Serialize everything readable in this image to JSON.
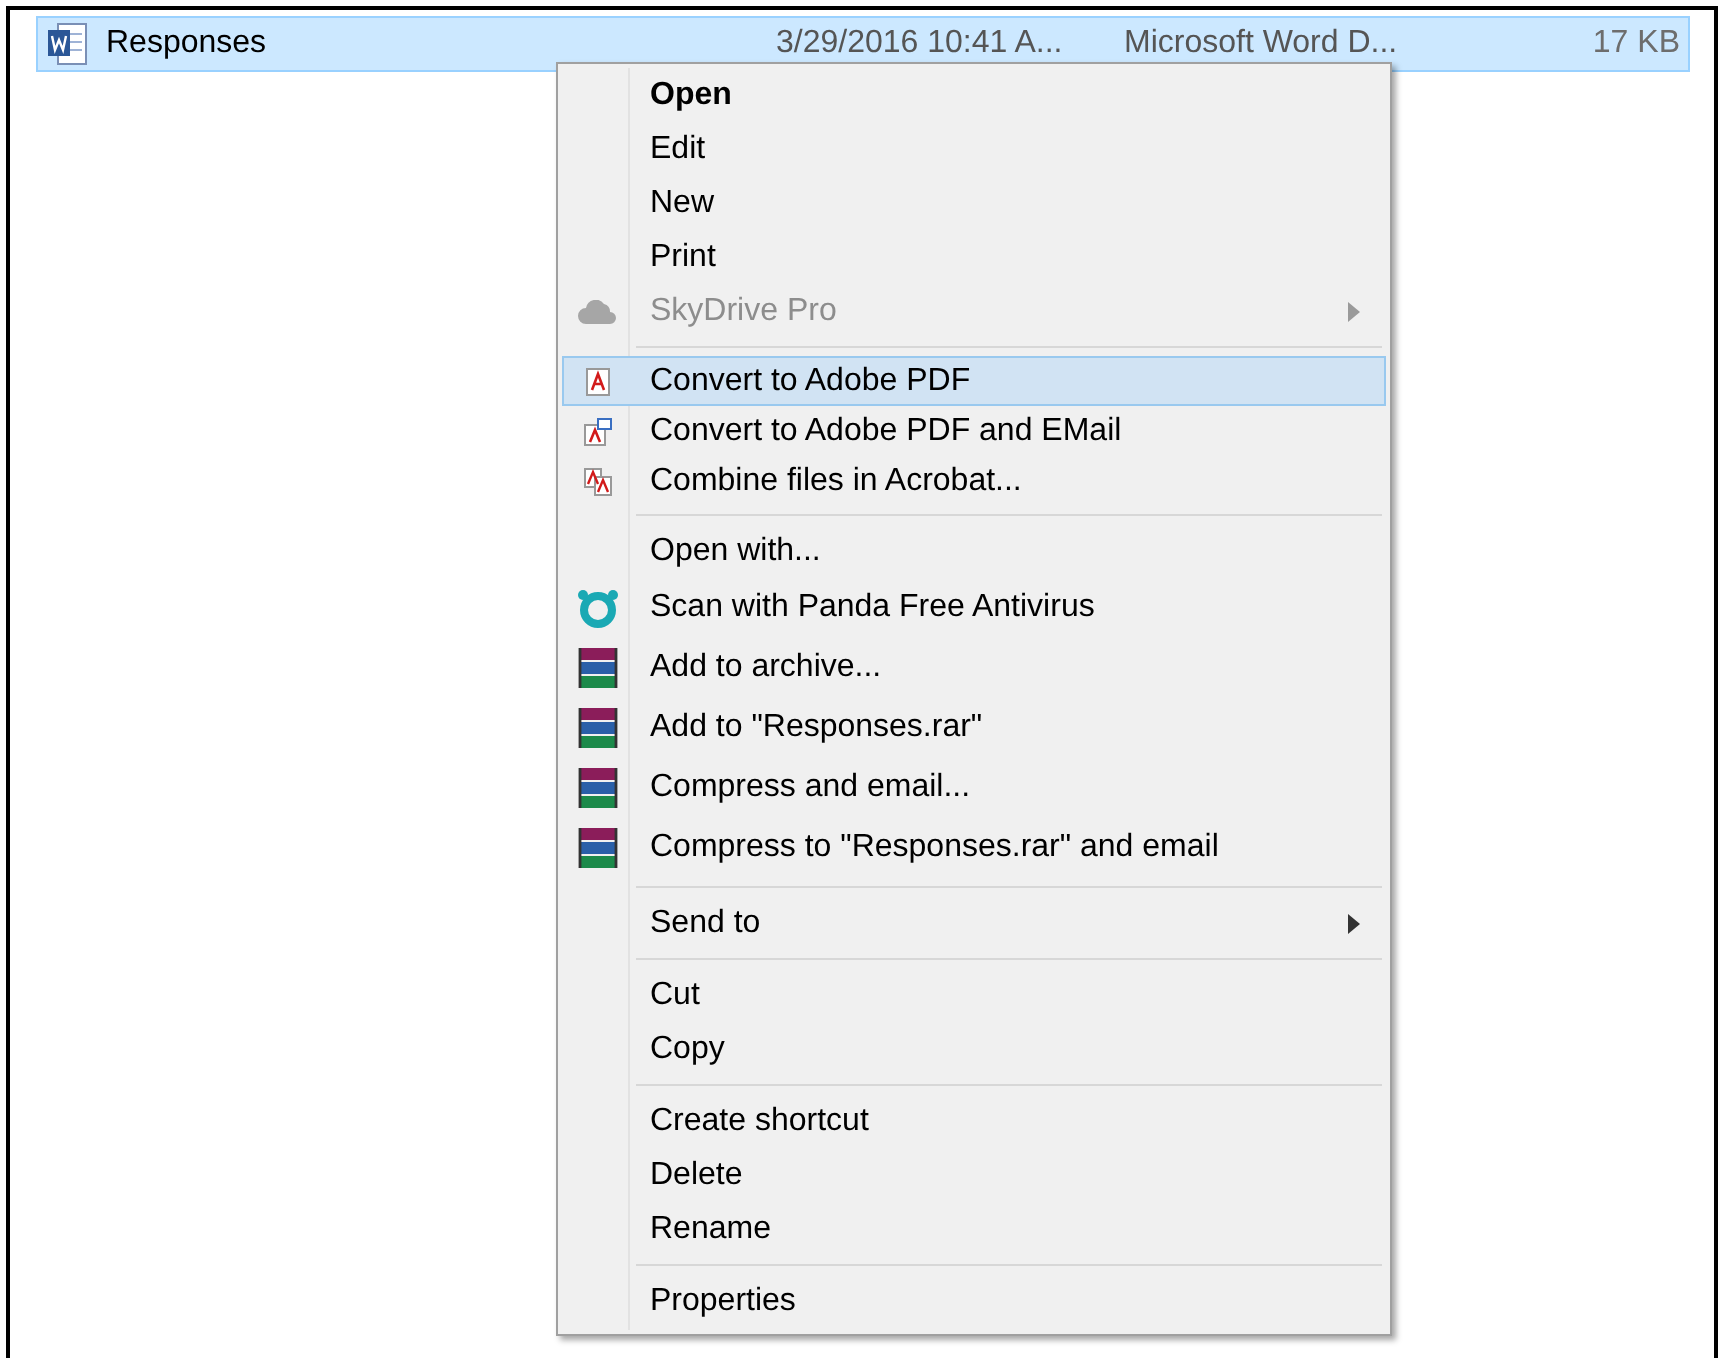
{
  "file_row": {
    "name": "Responses",
    "date": "3/29/2016 10:41 A...",
    "type": "Microsoft Word D...",
    "size": "17 KB",
    "selected": true
  },
  "context_menu": {
    "groups": [
      {
        "items": [
          {
            "label": "Open",
            "bold": true,
            "selected": false,
            "disabled": false,
            "submenu": false
          },
          {
            "label": "Edit",
            "bold": false,
            "selected": false,
            "disabled": false,
            "submenu": false
          },
          {
            "label": "New",
            "bold": false,
            "selected": false,
            "disabled": false,
            "submenu": false
          },
          {
            "label": "Print",
            "bold": false,
            "selected": false,
            "disabled": false,
            "submenu": false
          },
          {
            "label": "SkyDrive Pro",
            "kind": "cloud",
            "bold": false,
            "selected": false,
            "disabled": true,
            "submenu": true
          }
        ]
      },
      {
        "items": [
          {
            "label": "Convert to Adobe PDF",
            "kind": "pdf",
            "bold": false,
            "selected": true,
            "disabled": false,
            "submenu": false
          },
          {
            "label": "Convert to Adobe PDF and EMail",
            "kind": "pdf-mail",
            "bold": false,
            "selected": false,
            "disabled": false,
            "submenu": false
          },
          {
            "label": "Combine files in Acrobat...",
            "kind": "pdf-combine",
            "bold": false,
            "selected": false,
            "disabled": false,
            "submenu": false
          }
        ]
      },
      {
        "items": [
          {
            "label": "Open with...",
            "bold": false,
            "selected": false,
            "disabled": false,
            "submenu": false
          },
          {
            "label": "Scan with Panda Free Antivirus",
            "kind": "panda",
            "bold": false,
            "selected": false,
            "disabled": false,
            "submenu": false
          },
          {
            "label": "Add to archive...",
            "kind": "books",
            "bold": false,
            "selected": false,
            "disabled": false,
            "submenu": false
          },
          {
            "label": "Add to \"Responses.rar\"",
            "kind": "books",
            "bold": false,
            "selected": false,
            "disabled": false,
            "submenu": false
          },
          {
            "label": "Compress and email...",
            "kind": "books",
            "bold": false,
            "selected": false,
            "disabled": false,
            "submenu": false
          },
          {
            "label": "Compress to \"Responses.rar\" and email",
            "kind": "books",
            "bold": false,
            "selected": false,
            "disabled": false,
            "submenu": false
          }
        ]
      },
      {
        "items": [
          {
            "label": "Send to",
            "bold": false,
            "selected": false,
            "disabled": false,
            "submenu": true
          }
        ]
      },
      {
        "items": [
          {
            "label": "Cut",
            "bold": false,
            "selected": false,
            "disabled": false,
            "submenu": false
          },
          {
            "label": "Copy",
            "bold": false,
            "selected": false,
            "disabled": false,
            "submenu": false
          }
        ]
      },
      {
        "items": [
          {
            "label": "Create shortcut",
            "bold": false,
            "selected": false,
            "disabled": false,
            "submenu": false
          },
          {
            "label": "Delete",
            "bold": false,
            "selected": false,
            "disabled": false,
            "submenu": false
          },
          {
            "label": "Rename",
            "bold": false,
            "selected": false,
            "disabled": false,
            "submenu": false
          }
        ]
      },
      {
        "items": [
          {
            "label": "Properties",
            "bold": false,
            "selected": false,
            "disabled": false,
            "submenu": false
          }
        ]
      }
    ]
  }
}
